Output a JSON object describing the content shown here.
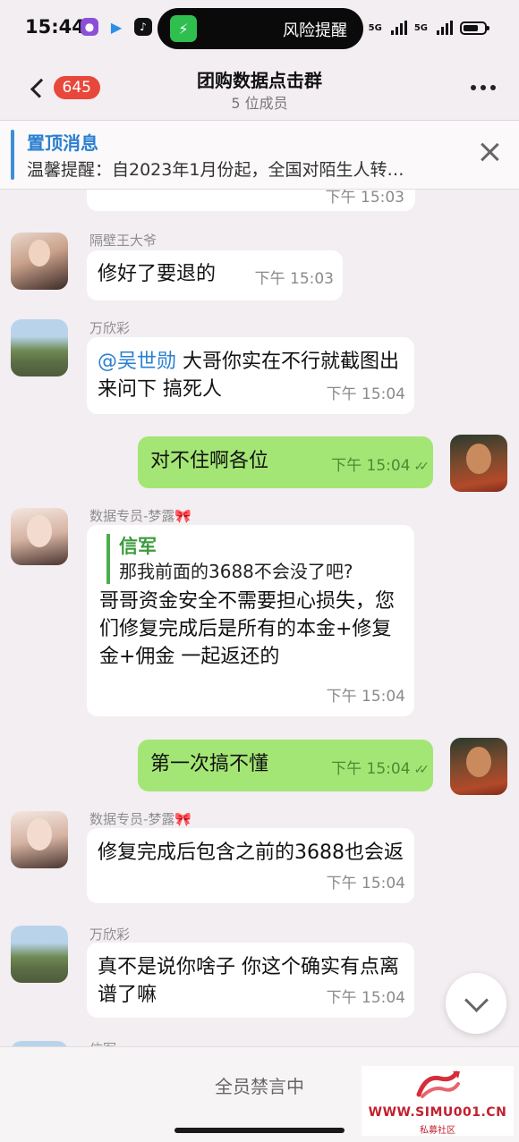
{
  "status_bar": {
    "time": "15:44",
    "island_text": "风险提醒",
    "network_1": "5G",
    "network_2": "5G"
  },
  "header": {
    "unread_count": "645",
    "title": "团购数据点击群",
    "subtitle": "5 位成员"
  },
  "pinned": {
    "title": "置顶消息",
    "text": "温馨提醒：自2023年1月份起，全国对陌生人转…"
  },
  "messages": [
    {
      "id": "m0",
      "mine": false,
      "time": "下午 15:03"
    },
    {
      "id": "m1",
      "mine": false,
      "sender": "隔壁王大爷",
      "text": "修好了要退的",
      "time": "下午 15:03"
    },
    {
      "id": "m2",
      "mine": false,
      "sender": "万欣彩",
      "mention": "@吴世勋",
      "text": " 大哥你实在不行就截图出来问下 搞死人",
      "time": "下午 15:04"
    },
    {
      "id": "m3",
      "mine": true,
      "text": "对不住啊各位",
      "time": "下午 15:04"
    },
    {
      "id": "m4",
      "mine": false,
      "sender": "数据专员-梦露🎀",
      "reply_name": "信军",
      "reply_text": "那我前面的3688不会没了吧?",
      "text": "哥哥资金安全不需要担心损失，您们修复完成后是所有的本金+修复金+佣金 一起返还的",
      "time": "下午 15:04"
    },
    {
      "id": "m5",
      "mine": true,
      "text": "第一次搞不懂",
      "time": "下午 15:04"
    },
    {
      "id": "m6",
      "mine": false,
      "sender": "数据专员-梦露🎀",
      "text": "修复完成后包含之前的3688也会返",
      "time": "下午 15:04"
    },
    {
      "id": "m7",
      "mine": false,
      "sender": "万欣彩",
      "text": "真不是说你啥子 你这个确实有点离谱了嘛",
      "time": "下午 15:04"
    },
    {
      "id": "m8",
      "mine": false,
      "sender": "信军"
    }
  ],
  "bottom": {
    "muted": "全员禁言中"
  },
  "watermark": {
    "url": "WWW.SIMU001.CN",
    "label": "私募社区"
  },
  "colors": {
    "accent_blue": "#2a7fd0",
    "badge_red": "#e8473c",
    "my_bubble": "#a4e675",
    "background": "#f3eef2"
  }
}
